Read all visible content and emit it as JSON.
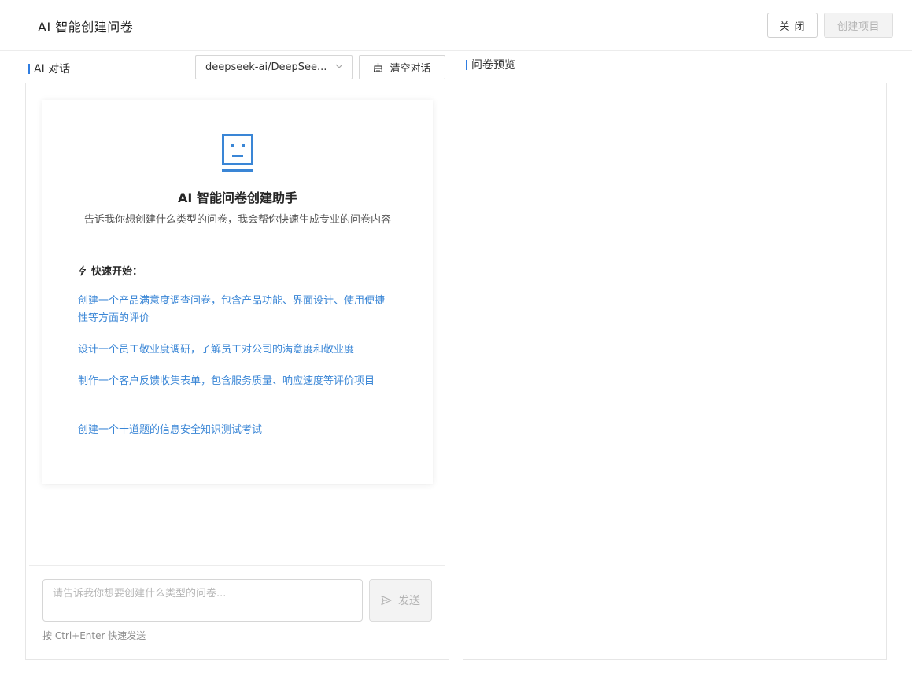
{
  "header": {
    "title": "AI 智能创建问卷",
    "close_label": "关 闭",
    "create_project_label": "创建项目"
  },
  "chat": {
    "section_label": "AI 对话",
    "model_selected": "deepseek-ai/DeepSee...",
    "clear_label": "清空对话",
    "welcome": {
      "icon": "robot-icon",
      "title": "AI 智能问卷创建助手",
      "description": "告诉我你想创建什么类型的问卷，我会帮你快速生成专业的问卷内容",
      "quick_start_label": "快速开始：",
      "suggestions": [
        "创建一个产品满意度调查问卷，包含产品功能、界面设计、使用便捷性等方面的评价",
        "设计一个员工敬业度调研，了解员工对公司的满意度和敬业度",
        "制作一个客户反馈收集表单，包含服务质量、响应速度等评价项目",
        "创建一个十道题的信息安全知识测试考试"
      ]
    },
    "input_placeholder": "请告诉我你想要创建什么类型的问卷...",
    "input_value": "",
    "send_label": "发送",
    "hint": "按 Ctrl+Enter 快速发送"
  },
  "preview": {
    "section_label": "问卷预览"
  },
  "colors": {
    "accent": "#2f7de1",
    "link": "#3a86d6",
    "disabled_bg": "#f3f3f3",
    "disabled_text": "#b4b4b4"
  }
}
